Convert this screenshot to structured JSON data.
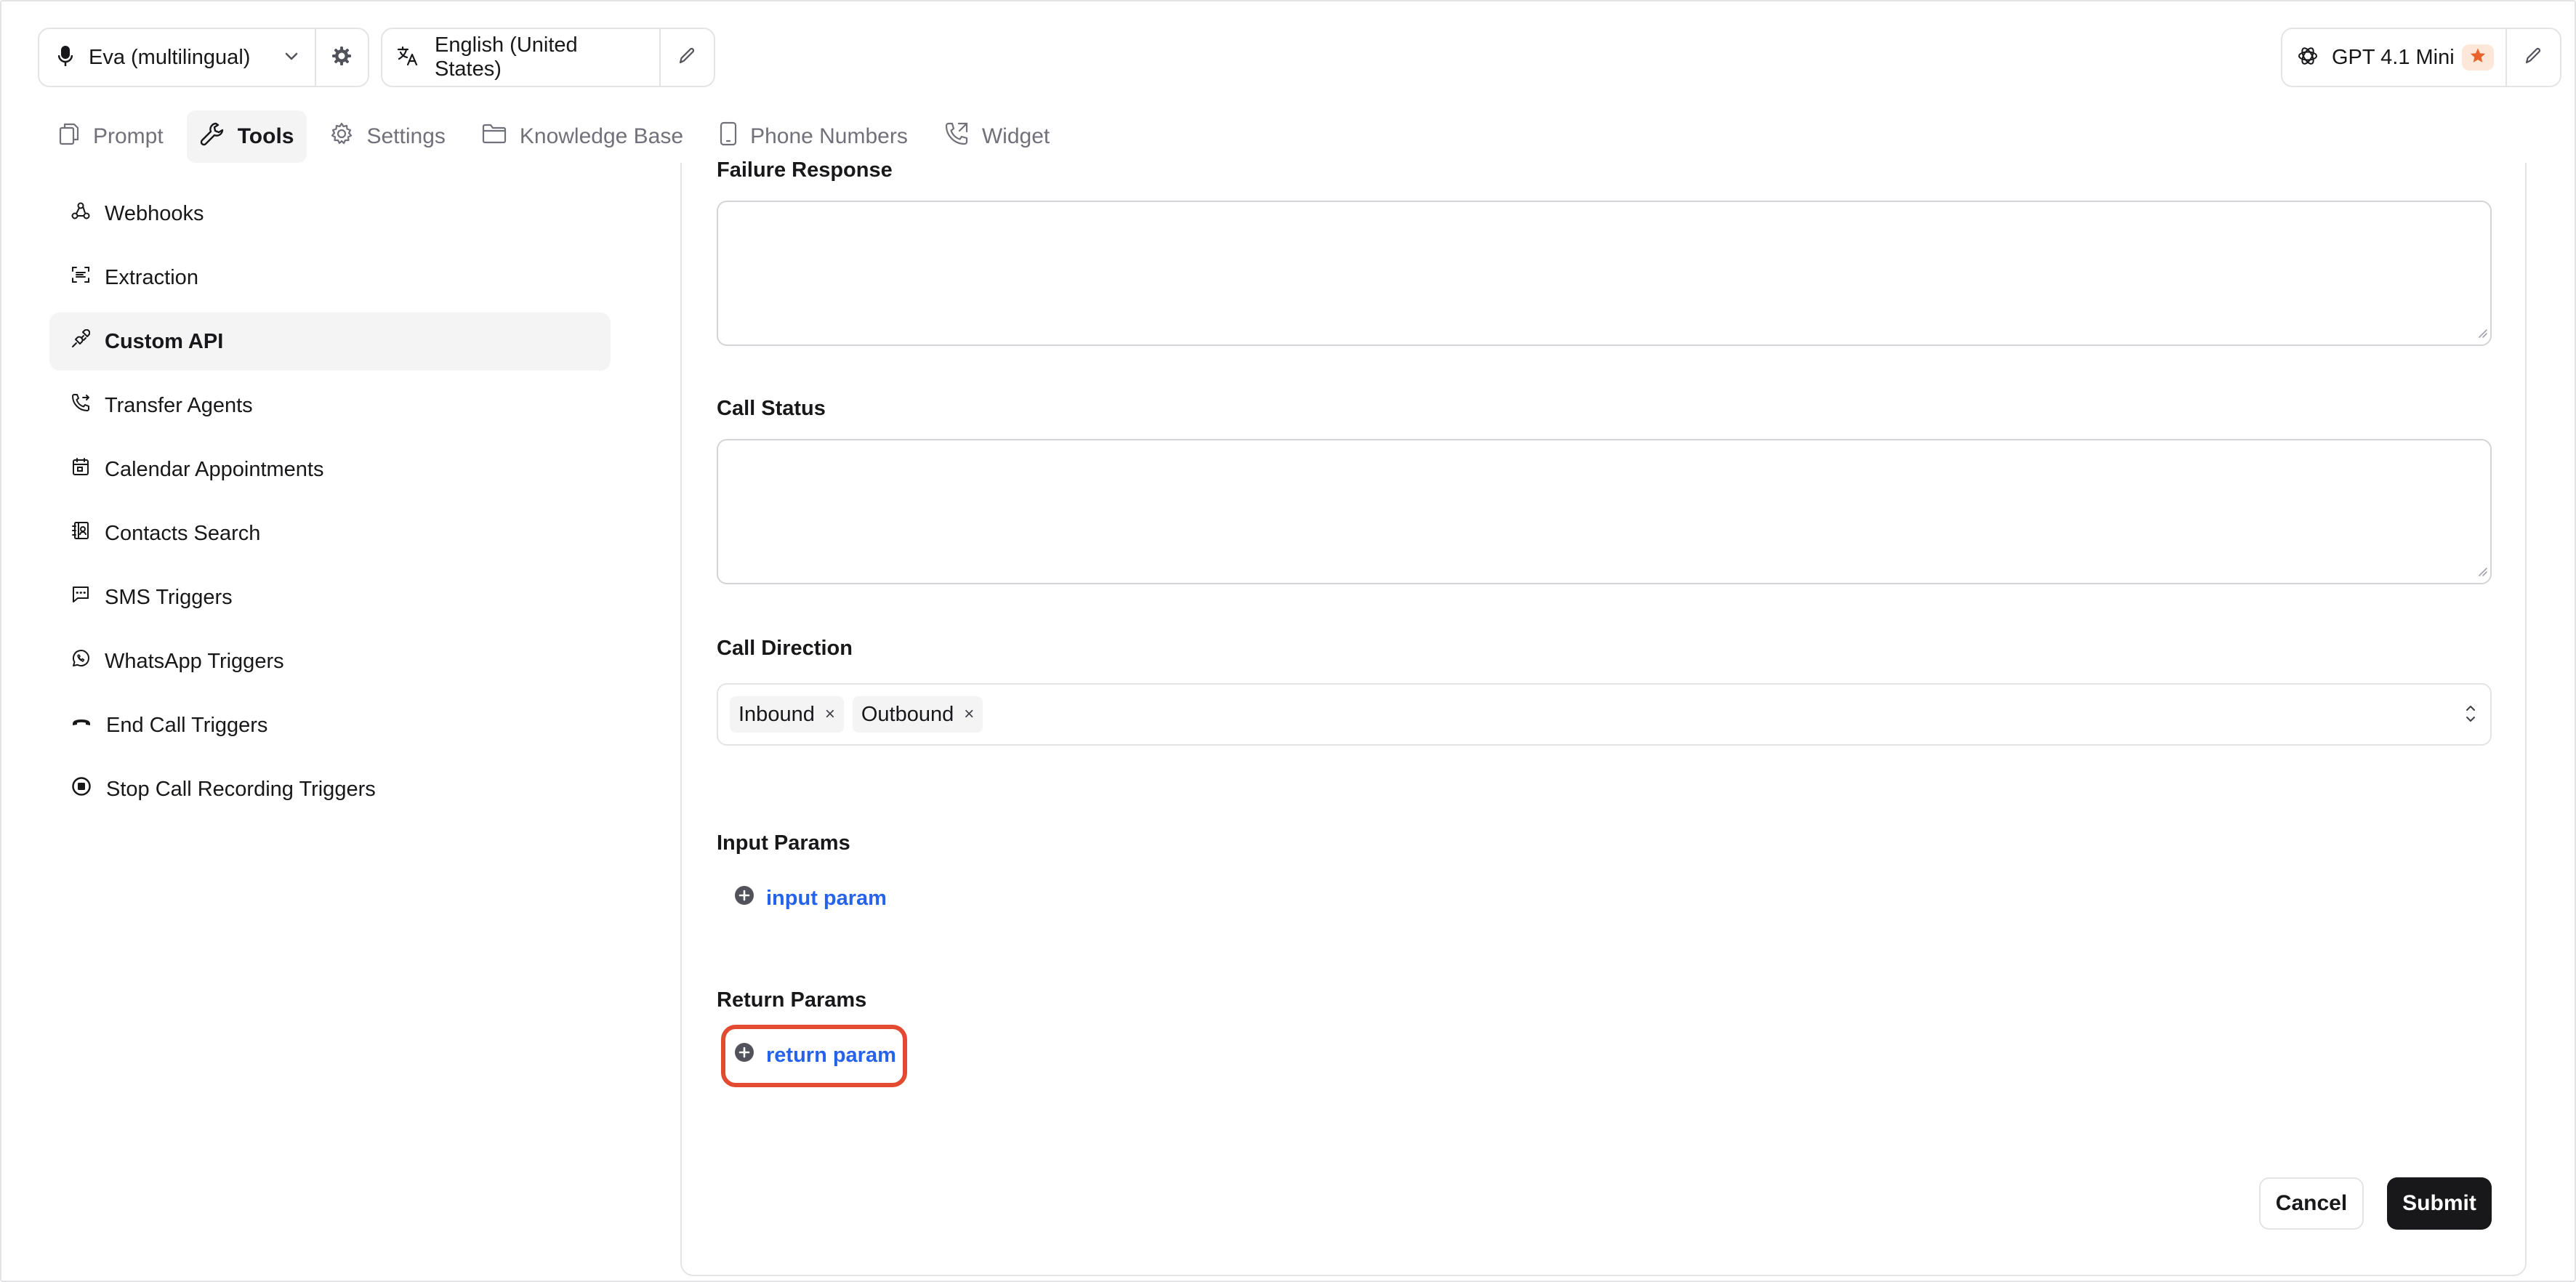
{
  "header": {
    "voice": {
      "label": "Eva (multilingual)"
    },
    "language": {
      "label": "English (United States)"
    },
    "model": {
      "label": "GPT 4.1 Mini"
    }
  },
  "tabs": [
    {
      "label": "Prompt",
      "icon": "copy-icon",
      "active": false
    },
    {
      "label": "Tools",
      "icon": "wrench-icon",
      "active": true
    },
    {
      "label": "Settings",
      "icon": "gear-icon",
      "active": false
    },
    {
      "label": "Knowledge Base",
      "icon": "folder-icon",
      "active": false
    },
    {
      "label": "Phone Numbers",
      "icon": "smartphone-icon",
      "active": false
    },
    {
      "label": "Widget",
      "icon": "phone-call-icon",
      "active": false
    }
  ],
  "sidebar": {
    "items": [
      {
        "label": "Webhooks",
        "icon": "webhook-icon"
      },
      {
        "label": "Extraction",
        "icon": "scan-text-icon"
      },
      {
        "label": "Custom API",
        "icon": "plug-icon",
        "active": true
      },
      {
        "label": "Transfer Agents",
        "icon": "phone-forward-icon"
      },
      {
        "label": "Calendar Appointments",
        "icon": "calendar-icon"
      },
      {
        "label": "Contacts Search",
        "icon": "contact-book-icon"
      },
      {
        "label": "SMS Triggers",
        "icon": "message-square-icon"
      },
      {
        "label": "WhatsApp Triggers",
        "icon": "whatsapp-icon"
      },
      {
        "label": "End Call Triggers",
        "icon": "phone-hangup-icon"
      },
      {
        "label": "Stop Call Recording Triggers",
        "icon": "stop-circle-icon"
      }
    ]
  },
  "form": {
    "failure_response": {
      "label": "Failure Response",
      "value": ""
    },
    "call_status": {
      "label": "Call Status",
      "value": ""
    },
    "call_direction": {
      "label": "Call Direction",
      "chips": [
        "Inbound",
        "Outbound"
      ],
      "remove_glyph": "×"
    },
    "input_params": {
      "label": "Input Params",
      "add_label": "input param"
    },
    "return_params": {
      "label": "Return Params",
      "add_label": "return param"
    },
    "cancel_label": "Cancel",
    "submit_label": "Submit"
  },
  "colors": {
    "accent_link": "#2563eb",
    "highlight": "#e34a32",
    "primary_button": "#18181b",
    "star": "#e8642c"
  }
}
